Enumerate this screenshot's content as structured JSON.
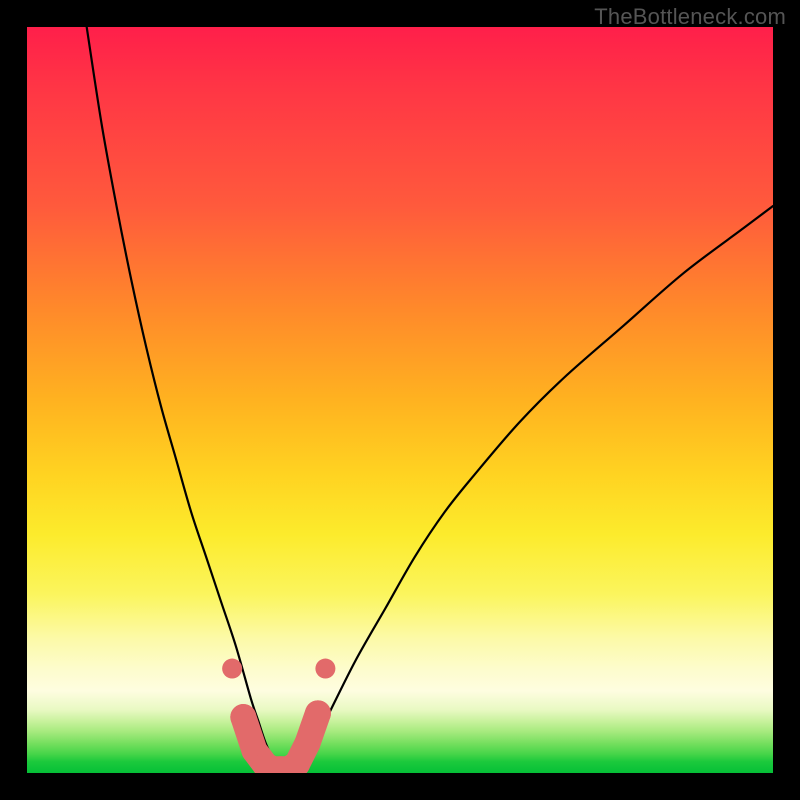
{
  "watermark": "TheBottleneck.com",
  "chart_data": {
    "type": "line",
    "title": "",
    "xlabel": "",
    "ylabel": "",
    "xlim": [
      0,
      100
    ],
    "ylim": [
      0,
      100
    ],
    "grid": false,
    "gradient_stops": [
      {
        "pos": 0,
        "color": "#ff1f4a"
      },
      {
        "pos": 8,
        "color": "#ff3545"
      },
      {
        "pos": 24,
        "color": "#ff5a3c"
      },
      {
        "pos": 38,
        "color": "#ff8a2a"
      },
      {
        "pos": 50,
        "color": "#ffb220"
      },
      {
        "pos": 60,
        "color": "#ffd321"
      },
      {
        "pos": 68,
        "color": "#fceb2c"
      },
      {
        "pos": 76,
        "color": "#fbf55d"
      },
      {
        "pos": 82,
        "color": "#fcfaa8"
      },
      {
        "pos": 86,
        "color": "#fdfccc"
      },
      {
        "pos": 89,
        "color": "#fefde0"
      },
      {
        "pos": 91.5,
        "color": "#e9f9c3"
      },
      {
        "pos": 93,
        "color": "#c9f29e"
      },
      {
        "pos": 94.5,
        "color": "#a5ea7d"
      },
      {
        "pos": 96,
        "color": "#76df5f"
      },
      {
        "pos": 97.5,
        "color": "#45d448"
      },
      {
        "pos": 98.5,
        "color": "#1bc93c"
      },
      {
        "pos": 100,
        "color": "#05c037"
      }
    ],
    "series": [
      {
        "name": "bottleneck-curve",
        "color": "#000000",
        "x": [
          8,
          10,
          12,
          14,
          16,
          18,
          20,
          22,
          24,
          26,
          28,
          30,
          31,
          32,
          33,
          34,
          35,
          36,
          38,
          40,
          44,
          48,
          52,
          56,
          60,
          66,
          72,
          80,
          88,
          96,
          100
        ],
        "y": [
          100,
          87,
          76,
          66,
          57,
          49,
          42,
          35,
          29,
          23,
          17,
          10,
          7,
          4,
          2,
          1,
          0.5,
          1,
          3,
          7,
          15,
          22,
          29,
          35,
          40,
          47,
          53,
          60,
          67,
          73,
          76
        ]
      }
    ],
    "markers": {
      "main_dots": {
        "color": "#e26a6a",
        "radius_px": 10,
        "points": [
          {
            "x": 27.5,
            "y": 14
          },
          {
            "x": 40.0,
            "y": 14
          }
        ]
      },
      "beads": {
        "color": "#e26a6a",
        "radius_px": 13,
        "spacing_px": 15,
        "pill_half_width_x": 2.6,
        "points": [
          {
            "x": 29.0,
            "y": 7.5
          },
          {
            "x": 30.5,
            "y": 3
          },
          {
            "x": 32.0,
            "y": 1
          },
          {
            "x": 33.0,
            "y": 0.5
          },
          {
            "x": 34.0,
            "y": 0.5
          },
          {
            "x": 35.0,
            "y": 0.5
          },
          {
            "x": 36.2,
            "y": 1.2
          },
          {
            "x": 37.6,
            "y": 4
          },
          {
            "x": 39.0,
            "y": 8
          }
        ]
      }
    }
  }
}
